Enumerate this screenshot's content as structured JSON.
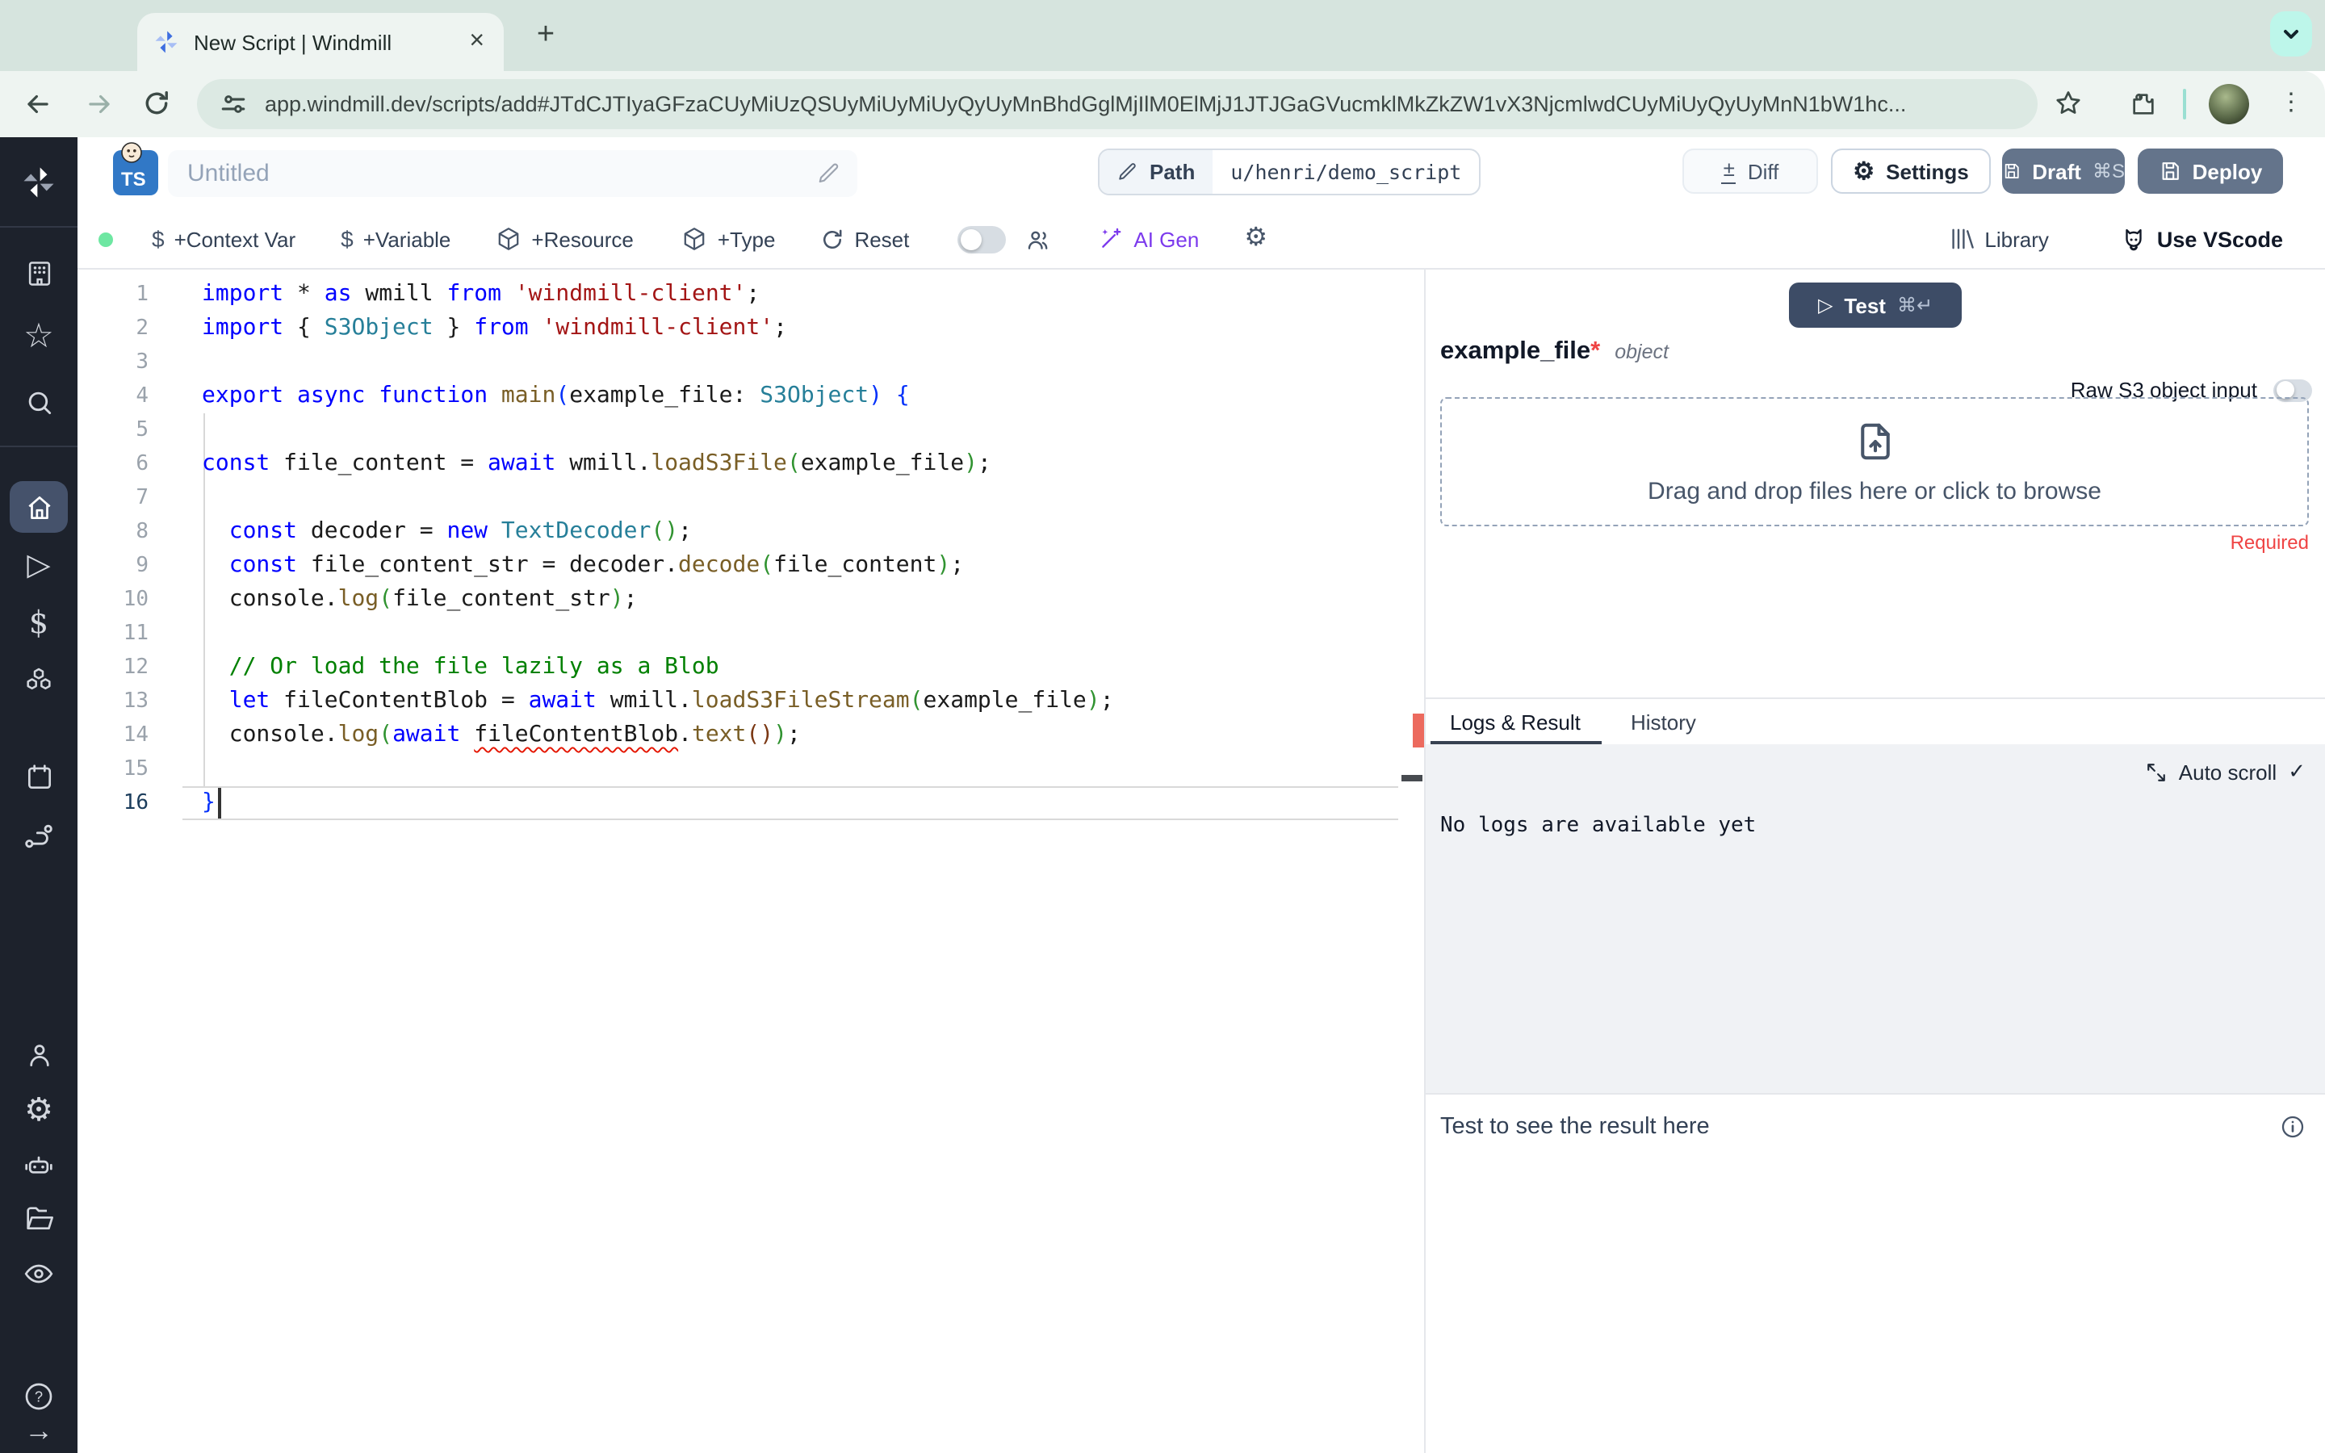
{
  "browser": {
    "tab_title": "New Script | Windmill",
    "close_tab": "×",
    "new_tab": "+",
    "url": "app.windmill.dev/scripts/add#JTdCJTIyaGFzaCUyMiUzQSUyMiUyMiUyQyUyMnBhdGglMjIlM0ElMjJ1JTJGaGVucmklMkZkZW1vX3NjcmlwdCUyMiUyQyUyMnN1bW1hc...",
    "menu_dots": "⋮"
  },
  "header": {
    "lang_badge": "TS",
    "script_title": "Untitled",
    "path_label": "Path",
    "path_value": "u/henri/demo_script",
    "diff_sign": "±",
    "diff_label": "Diff",
    "settings_gear": "⚙",
    "settings_label": "Settings",
    "draft_label": "Draft",
    "draft_shortcut": "⌘S",
    "deploy_label": "Deploy"
  },
  "toolbar": {
    "dollar": "$",
    "context_var": "+Context Var",
    "variable": "+Variable",
    "resource": "+Resource",
    "type": "+Type",
    "reset": "Reset",
    "ai_gen": "AI Gen",
    "gear": "⚙",
    "library": "Library",
    "use_vscode": "Use VScode"
  },
  "sidebar": {
    "icons": [
      "windmill-logo",
      "workspace-building",
      "favorites-star",
      "search",
      "home",
      "runs-play",
      "variables-dollar",
      "resources-cubes",
      "schedules-calendar",
      "routes-flow",
      "users-person",
      "settings-gear",
      "workers-robot",
      "folders",
      "audit-eye",
      "help-question",
      "expand-arrow"
    ],
    "glyphs": {
      "star": "☆",
      "play": "▷",
      "dollar": "$",
      "gear": "⚙",
      "help": "?",
      "arrow": "→"
    }
  },
  "editor": {
    "active_line": 16,
    "lines": [
      [
        [
          "import ",
          "kw"
        ],
        [
          "* ",
          "pl"
        ],
        [
          "as ",
          "kw"
        ],
        [
          "wmill ",
          "pl"
        ],
        [
          "from ",
          "kw"
        ],
        [
          "'windmill-client'",
          "str"
        ],
        [
          ";",
          "pl"
        ]
      ],
      [
        [
          "import ",
          "kw"
        ],
        [
          "{ ",
          "pl"
        ],
        [
          "S3Object",
          "type"
        ],
        [
          " } ",
          "pl"
        ],
        [
          "from ",
          "kw"
        ],
        [
          "'windmill-client'",
          "str"
        ],
        [
          ";",
          "pl"
        ]
      ],
      [],
      [
        [
          "export ",
          "kw"
        ],
        [
          "async ",
          "kw"
        ],
        [
          "function ",
          "kw"
        ],
        [
          "main",
          "fn"
        ],
        [
          "(",
          "b1"
        ],
        [
          "example_file",
          "pl"
        ],
        [
          ": ",
          "pl"
        ],
        [
          "S3Object",
          "type"
        ],
        [
          ")",
          "b1"
        ],
        [
          " ",
          "pl"
        ],
        [
          "{",
          "b1"
        ]
      ],
      [],
      [
        [
          "const ",
          "kw"
        ],
        [
          "file_content = ",
          "pl"
        ],
        [
          "await ",
          "kw"
        ],
        [
          "wmill.",
          "pl"
        ],
        [
          "loadS3File",
          "fn"
        ],
        [
          "(",
          "b2"
        ],
        [
          "example_file",
          "pl"
        ],
        [
          ")",
          "b2"
        ],
        [
          ";",
          "pl"
        ]
      ],
      [],
      [
        [
          "  ",
          "pl"
        ],
        [
          "const ",
          "kw"
        ],
        [
          "decoder = ",
          "pl"
        ],
        [
          "new ",
          "kw"
        ],
        [
          "TextDecoder",
          "type"
        ],
        [
          "(",
          "b2"
        ],
        [
          ")",
          "b2"
        ],
        [
          ";",
          "pl"
        ]
      ],
      [
        [
          "  ",
          "pl"
        ],
        [
          "const ",
          "kw"
        ],
        [
          "file_content_str = decoder.",
          "pl"
        ],
        [
          "decode",
          "fn"
        ],
        [
          "(",
          "b2"
        ],
        [
          "file_content",
          "pl"
        ],
        [
          ")",
          "b2"
        ],
        [
          ";",
          "pl"
        ]
      ],
      [
        [
          "  console.",
          "pl"
        ],
        [
          "log",
          "fn"
        ],
        [
          "(",
          "b2"
        ],
        [
          "file_content_str",
          "pl"
        ],
        [
          ")",
          "b2"
        ],
        [
          ";",
          "pl"
        ]
      ],
      [],
      [
        [
          "  ",
          "pl"
        ],
        [
          "// Or load the file lazily as a Blob",
          "cm"
        ]
      ],
      [
        [
          "  ",
          "pl"
        ],
        [
          "let ",
          "kw"
        ],
        [
          "fileContentBlob = ",
          "pl"
        ],
        [
          "await ",
          "kw"
        ],
        [
          "wmill.",
          "pl"
        ],
        [
          "loadS3FileStream",
          "fn"
        ],
        [
          "(",
          "b2"
        ],
        [
          "example_file",
          "pl"
        ],
        [
          ")",
          "b2"
        ],
        [
          ";",
          "pl"
        ]
      ],
      [
        [
          "  console.",
          "pl"
        ],
        [
          "log",
          "fn"
        ],
        [
          "(",
          "b2"
        ],
        [
          "await ",
          "kw"
        ],
        [
          "fileContentBlob",
          "err"
        ],
        [
          ".",
          "pl"
        ],
        [
          "text",
          "fn"
        ],
        [
          "(",
          "b3"
        ],
        [
          ")",
          "b3"
        ],
        [
          ")",
          "b2"
        ],
        [
          ";",
          "pl"
        ]
      ],
      [],
      [
        [
          "}",
          "b1"
        ]
      ]
    ]
  },
  "panel": {
    "test_play": "▷",
    "test_label": "Test",
    "test_shortcut": "⌘↵",
    "arg_name": "example_file",
    "arg_required_star": "*",
    "arg_type": "object",
    "raw_s3_label": "Raw S3 object input",
    "dropzone_label": "Drag and drop files here or click to browse",
    "required_label": "Required",
    "tab_logs": "Logs & Result",
    "tab_history": "History",
    "auto_scroll_label": "Auto scroll",
    "auto_scroll_check": "✓",
    "no_logs_text": "No logs are available yet",
    "result_placeholder": "Test to see the result here"
  }
}
